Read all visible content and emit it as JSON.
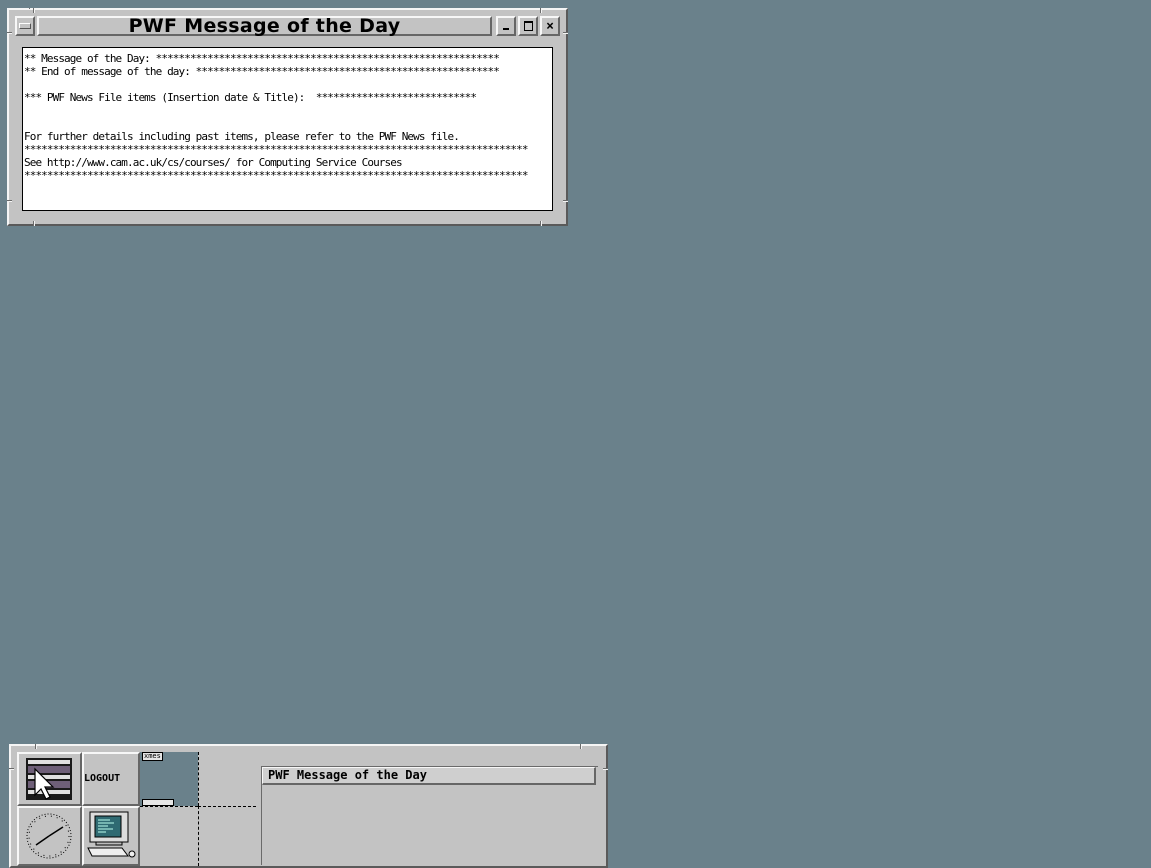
{
  "motd_window": {
    "title": "PWF Message of the Day",
    "buttons": {
      "minimize": "minimize",
      "maximize": "maximize",
      "close": "×"
    },
    "lines": [
      "** Message of the Day: ************************************************************",
      "** End of message of the day: *****************************************************",
      "",
      "*** PWF News File items (Insertion date & Title):  ****************************",
      "",
      "",
      "For further details including past items, please refer to the PWF News file.",
      "****************************************************************************************",
      "See http://www.cam.ac.uk/cs/courses/ for Computing Service Courses",
      "****************************************************************************************"
    ]
  },
  "front_panel": {
    "logout_label": "LOGOUT",
    "workspace_label": "xmes",
    "window_list": [
      {
        "label": "PWF Message of the Day"
      }
    ]
  },
  "colors": {
    "desktop": "#6a818b",
    "chrome": "#c3c3c3"
  }
}
